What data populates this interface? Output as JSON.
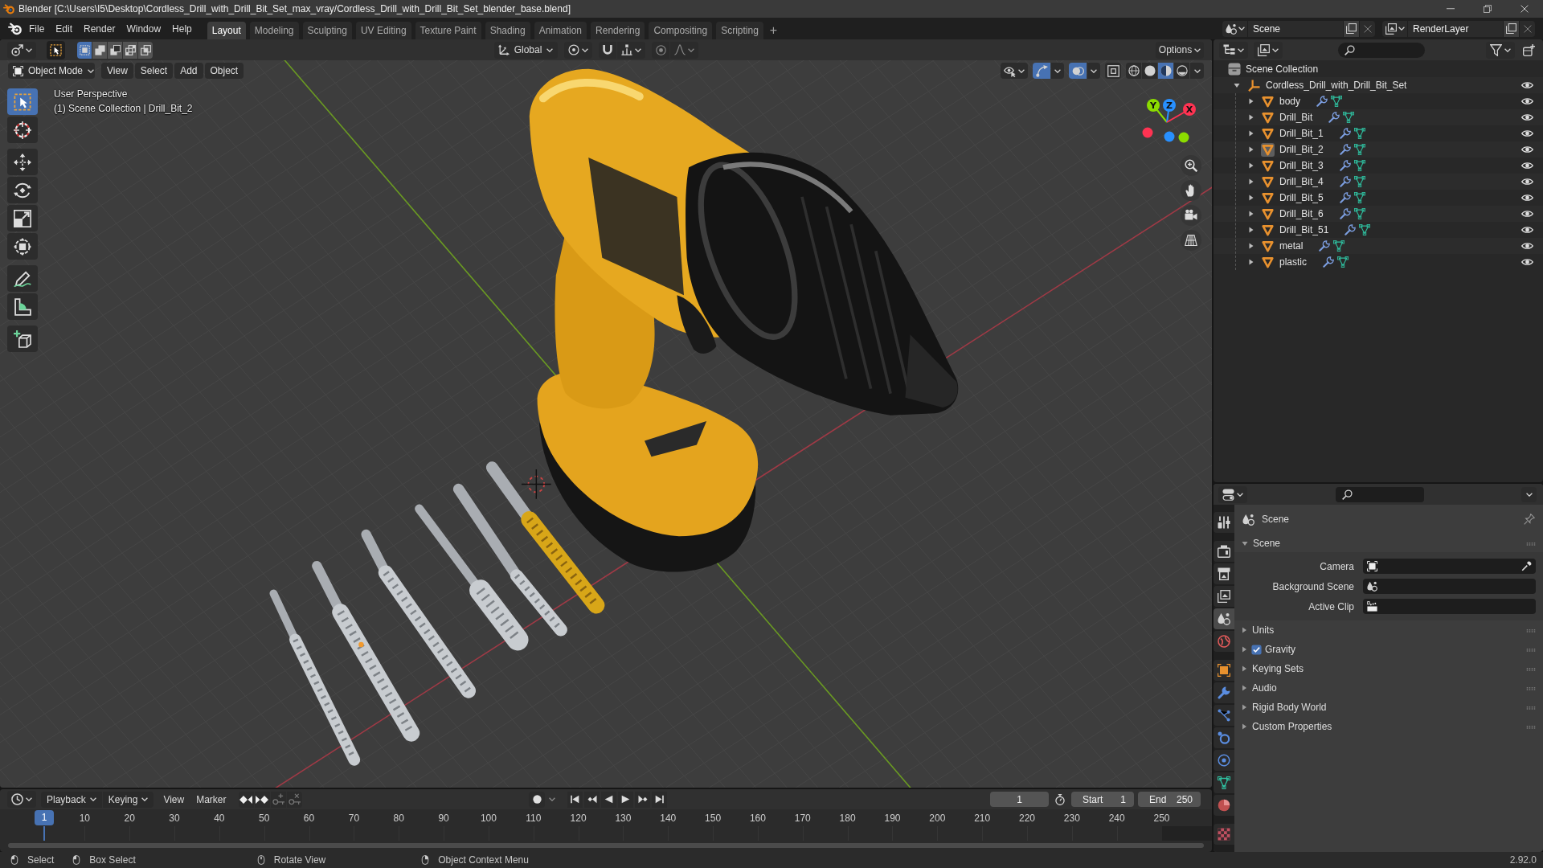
{
  "window": {
    "title": "Blender [C:\\Users\\I5\\Desktop\\Cordless_Drill_with_Drill_Bit_Set_max_vray/Cordless_Drill_with_Drill_Bit_Set_blender_base.blend]"
  },
  "menu": [
    "File",
    "Edit",
    "Render",
    "Window",
    "Help"
  ],
  "workspaces": [
    {
      "label": "Layout",
      "selected": true
    },
    {
      "label": "Modeling",
      "selected": false
    },
    {
      "label": "Sculpting",
      "selected": false
    },
    {
      "label": "UV Editing",
      "selected": false
    },
    {
      "label": "Texture Paint",
      "selected": false
    },
    {
      "label": "Shading",
      "selected": false
    },
    {
      "label": "Animation",
      "selected": false
    },
    {
      "label": "Rendering",
      "selected": false
    },
    {
      "label": "Compositing",
      "selected": false
    },
    {
      "label": "Scripting",
      "selected": false
    }
  ],
  "add_workspace": "+",
  "scene": "Scene",
  "view_layer": "RenderLayer",
  "viewport": {
    "select_modes": [
      {
        "kind": "new",
        "selected": true
      },
      {
        "kind": "extend",
        "selected": false
      },
      {
        "kind": "subtract",
        "selected": false
      },
      {
        "kind": "difference",
        "selected": false
      },
      {
        "kind": "intersect",
        "selected": false
      }
    ],
    "orientation": "Global",
    "options": "Options",
    "mode": "Object Mode",
    "menus": [
      "View",
      "Select",
      "Add",
      "Object"
    ],
    "toggles": [
      {
        "kind": "gizmos",
        "on": true
      },
      {
        "kind": "overlays",
        "on": true
      },
      {
        "kind": "xray",
        "on": false
      }
    ],
    "shading": [
      {
        "kind": "wireframe",
        "selected": false
      },
      {
        "kind": "solid",
        "selected": false
      },
      {
        "kind": "material",
        "selected": true
      },
      {
        "kind": "rendered",
        "selected": false
      }
    ],
    "tools": [
      {
        "kind": "select-box",
        "selected": true
      },
      {
        "kind": "cursor",
        "selected": false
      },
      {
        "kind": "move",
        "selected": false
      },
      {
        "kind": "rotate",
        "selected": false
      },
      {
        "kind": "scale",
        "selected": false
      },
      {
        "kind": "transform",
        "selected": false
      },
      {
        "kind": "annotate",
        "selected": false
      },
      {
        "kind": "measure",
        "selected": false
      },
      {
        "kind": "add-cube",
        "selected": false
      }
    ],
    "info": [
      "User Perspective",
      "(1) Scene Collection | Drill_Bit_2"
    ],
    "gizmo": {
      "axes": [
        {
          "label": "Y",
          "color": "#8bdc00"
        },
        {
          "label": "Z",
          "color": "#2890ff"
        },
        {
          "label": "X",
          "color": "#ff3352"
        }
      ],
      "negative_axes": [
        {
          "color": "#ff3352"
        },
        {
          "color": "#2890ff"
        },
        {
          "color": "#8bdc00"
        }
      ]
    }
  },
  "outliner": {
    "root": "Scene Collection",
    "collections": [
      {
        "label": "Cordless_Drill_with_Drill_Bit_Set",
        "expanded": true,
        "children": [
          {
            "label": "body",
            "expanded": false,
            "selected": false
          },
          {
            "label": "Drill_Bit",
            "expanded": false,
            "selected": false
          },
          {
            "label": "Drill_Bit_1",
            "expanded": false,
            "selected": false
          },
          {
            "label": "Drill_Bit_2",
            "expanded": false,
            "selected": true
          },
          {
            "label": "Drill_Bit_3",
            "expanded": false,
            "selected": false
          },
          {
            "label": "Drill_Bit_4",
            "expanded": false,
            "selected": false
          },
          {
            "label": "Drill_Bit_5",
            "expanded": false,
            "selected": false
          },
          {
            "label": "Drill_Bit_6",
            "expanded": false,
            "selected": false
          },
          {
            "label": "Drill_Bit_51",
            "expanded": false,
            "selected": false
          },
          {
            "label": "metal",
            "expanded": false,
            "selected": false
          },
          {
            "label": "plastic",
            "expanded": false,
            "selected": false
          }
        ]
      }
    ]
  },
  "properties": {
    "tabs": [
      {
        "kind": "tool",
        "selected": false
      },
      {
        "kind": "render",
        "selected": false
      },
      {
        "kind": "output",
        "selected": false
      },
      {
        "kind": "view-layer",
        "selected": false
      },
      {
        "kind": "scene",
        "selected": true
      },
      {
        "kind": "world",
        "selected": false
      },
      {
        "kind": "object",
        "selected": false
      },
      {
        "kind": "modifiers",
        "selected": false
      },
      {
        "kind": "particles",
        "selected": false
      },
      {
        "kind": "physics",
        "selected": false
      },
      {
        "kind": "constraints",
        "selected": false
      },
      {
        "kind": "data",
        "selected": false
      },
      {
        "kind": "material",
        "selected": false
      },
      {
        "kind": "texture",
        "selected": false
      }
    ],
    "context": "Scene",
    "panel": {
      "title": "Scene",
      "expanded": true,
      "fields": [
        {
          "label": "Camera",
          "kind": "camera"
        },
        {
          "label": "Background Scene",
          "kind": "scene"
        },
        {
          "label": "Active Clip",
          "kind": "clip"
        }
      ]
    },
    "subpanels": [
      {
        "label": "Units",
        "kind": "plain",
        "expanded": false
      },
      {
        "label": "Gravity",
        "kind": "checkbox",
        "checked": true,
        "expanded": false
      },
      {
        "label": "Keying Sets",
        "kind": "plain",
        "expanded": false
      },
      {
        "label": "Audio",
        "kind": "plain",
        "expanded": false
      },
      {
        "label": "Rigid Body World",
        "kind": "plain",
        "expanded": false
      },
      {
        "label": "Custom Properties",
        "kind": "plain",
        "expanded": false
      }
    ]
  },
  "timeline": {
    "menus": [
      "Playback",
      "Keying",
      "View",
      "Marker"
    ],
    "current_frame": "1",
    "start_label": "Start",
    "start": "1",
    "end_label": "End",
    "end": "250",
    "playhead": "1",
    "ruler": [
      "10",
      "20",
      "30",
      "40",
      "50",
      "60",
      "70",
      "80",
      "90",
      "100",
      "110",
      "120",
      "130",
      "140",
      "150",
      "160",
      "170",
      "180",
      "190",
      "200",
      "210",
      "220",
      "230",
      "240",
      "250"
    ]
  },
  "status_bar": {
    "hints": [
      {
        "kind": "lmb",
        "label": "Select"
      },
      {
        "kind": "lmb-drag",
        "label": "Box Select"
      },
      {
        "kind": "mmb",
        "label": "Rotate View"
      },
      {
        "kind": "rmb",
        "label": "Object Context Menu"
      }
    ],
    "version": "2.92.0"
  }
}
